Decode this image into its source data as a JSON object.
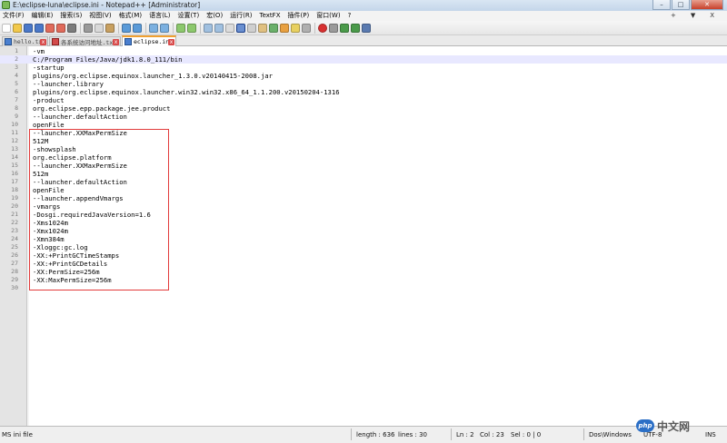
{
  "window": {
    "title": "E:\\eclipse-luna\\eclipse.ini - Notepad++ [Administrator]",
    "controls": [
      "–",
      "□",
      "✕"
    ]
  },
  "menu": {
    "items": [
      "文件(F)",
      "编辑(E)",
      "搜索(S)",
      "视图(V)",
      "格式(M)",
      "语言(L)",
      "设置(T)",
      "宏(O)",
      "运行(R)",
      "TextFX",
      "插件(P)",
      "窗口(W)",
      "?"
    ],
    "right": [
      "+",
      "▼",
      "X"
    ]
  },
  "tabs": [
    {
      "label": "hello.txt",
      "close": "x"
    },
    {
      "label": "各系统访问地址.txt",
      "close": "x"
    },
    {
      "label": "eclipse.ini",
      "close": "x"
    }
  ],
  "editor": {
    "current_line": 2,
    "lines": [
      "-vm",
      "C:/Program Files/Java/jdk1.8.0_111/bin",
      "-startup",
      "plugins/org.eclipse.equinox.launcher_1.3.0.v20140415-2008.jar",
      "--launcher.library",
      "plugins/org.eclipse.equinox.launcher.win32.win32.x86_64_1.1.200.v20150204-1316",
      "-product",
      "org.eclipse.epp.package.jee.product",
      "--launcher.defaultAction",
      "openFile",
      "--launcher.XXMaxPermSize",
      "512M",
      "-showsplash",
      "org.eclipse.platform",
      "--launcher.XXMaxPermSize",
      "512m",
      "--launcher.defaultAction",
      "openFile",
      "--launcher.appendVmargs",
      "-vmargs",
      "-Dosgi.requiredJavaVersion=1.6",
      "-Xms1024m",
      "-Xmx1024m",
      "-Xmn384m",
      "-Xloggc:gc.log",
      "-XX:+PrintGCTimeStamps",
      "-XX:+PrintGCDetails",
      "-XX:PermSize=256m",
      "-XX:MaxPermSize=256m",
      ""
    ]
  },
  "status": {
    "file_type": "MS ini file",
    "length": "length : 636",
    "lines": "lines : 30",
    "ln": "Ln : 2",
    "col": "Col : 23",
    "sel": "Sel : 0 | 0",
    "eol": "Dos\\Windows",
    "encoding": "UTF-8",
    "mode": "INS"
  },
  "watermark": {
    "logo": "php",
    "text": "中文网"
  },
  "colors": {
    "highlight_box": "#e23b3b",
    "current_line": "#e8e8ff",
    "active_tab_accent": "#f0a030"
  }
}
